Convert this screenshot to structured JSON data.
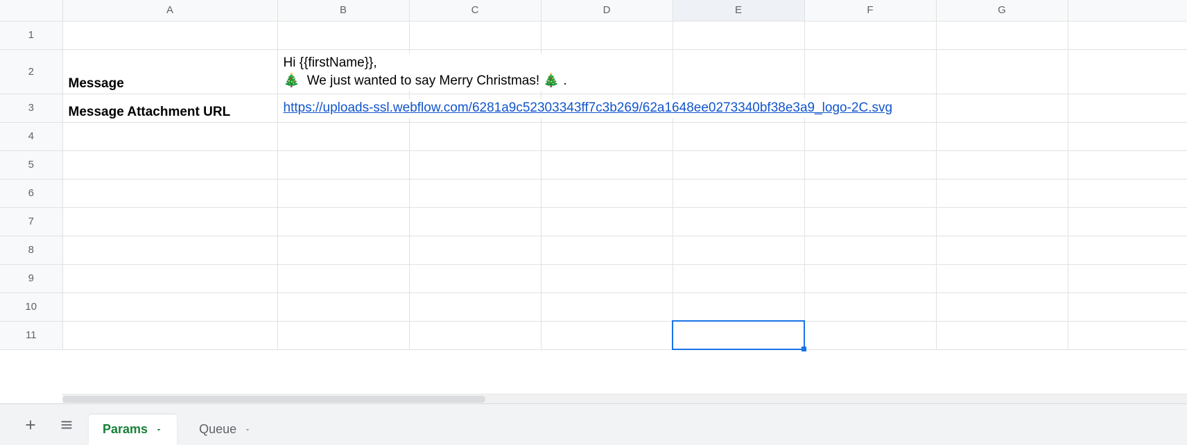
{
  "columns": [
    "A",
    "B",
    "C",
    "D",
    "E",
    "F",
    "G"
  ],
  "rowCount": 11,
  "selectedCell": "E11",
  "highlightedColumn": "E",
  "cells": {
    "A2": {
      "text": "Message",
      "bold": true
    },
    "B2": {
      "text": "Hi {{firstName}},\n🎄  We just wanted to say Merry Christmas! 🎄 .",
      "overflow": true,
      "multiline": true
    },
    "A3": {
      "text": "Message Attachment URL",
      "bold": true
    },
    "B3": {
      "text": "https://uploads-ssl.webflow.com/6281a9c52303343ff7c3b269/62a1648ee0273340bf38e3a9_logo-2C.svg",
      "link": true,
      "overflow": true
    }
  },
  "sheetTabs": [
    {
      "name": "Params",
      "active": true
    },
    {
      "name": "Queue",
      "active": false
    }
  ],
  "icons": {
    "addSheet": "plus-icon",
    "allSheets": "menu-icon"
  }
}
